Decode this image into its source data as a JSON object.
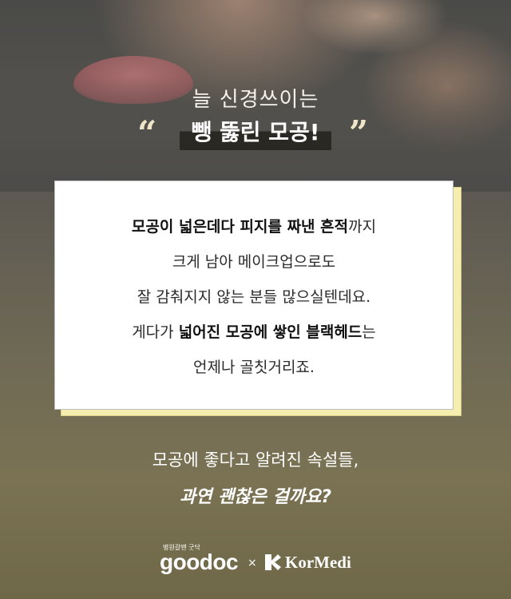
{
  "header": {
    "subtitle": "늘 신경쓰이는",
    "quote_open": "“",
    "title": "뺑 뚫린 모공!",
    "quote_close": "”"
  },
  "card": {
    "lines": [
      [
        {
          "text": "모공이 넓은데다 피지를 짜낸 흔적",
          "bold": true
        },
        {
          "text": "까지",
          "bold": false
        }
      ],
      [
        {
          "text": "크게 남아 메이크업으로도",
          "bold": false
        }
      ],
      [
        {
          "text": "잘 감춰지지 않는 분들 많으실텐데요.",
          "bold": false
        }
      ],
      [
        {
          "text": "게다가 ",
          "bold": false
        },
        {
          "text": "넓어진 모공에 쌓인 블랙헤드",
          "bold": true
        },
        {
          "text": "는",
          "bold": false
        }
      ],
      [
        {
          "text": "언제나 골칫거리죠.",
          "bold": false
        }
      ]
    ]
  },
  "footer": {
    "line1": "모공에 좋다고 알려진 속설들,",
    "line2": "과연 괜찮은 걸까요?"
  },
  "logos": {
    "goodoc_tagline": "병원갈땐 굿닥",
    "goodoc": "goodoc",
    "times": "×",
    "kormedi": "KorMedi"
  },
  "colors": {
    "card_shadow": "#f5eeb0",
    "card_bg": "#ffffff",
    "text_light": "#ffffff"
  }
}
